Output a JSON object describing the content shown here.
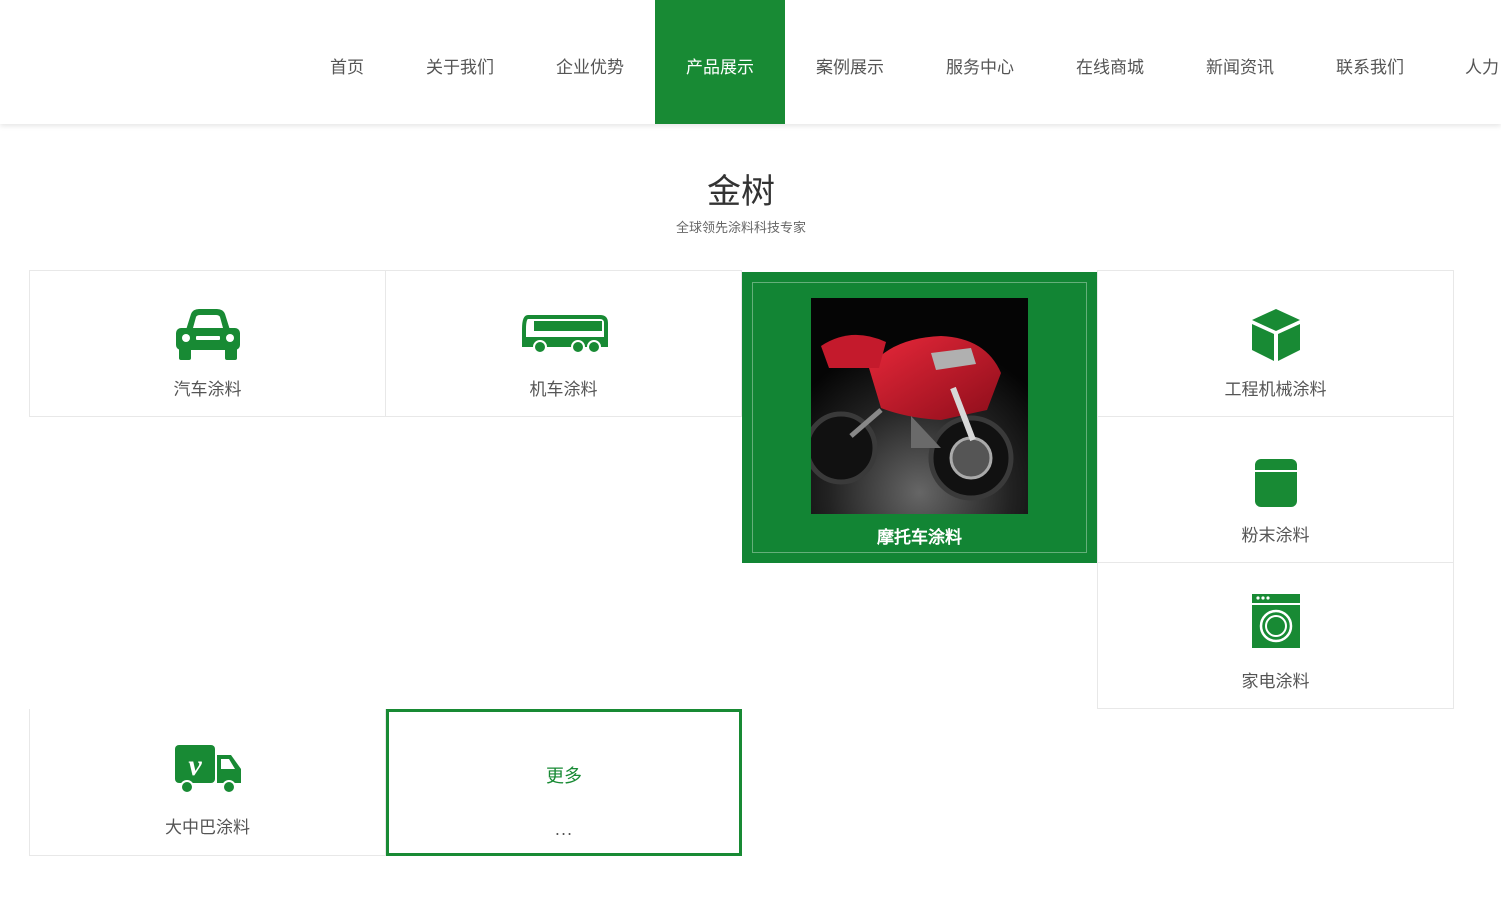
{
  "nav": {
    "items": [
      "首页",
      "关于我们",
      "企业优势",
      "产品展示",
      "案例展示",
      "服务中心",
      "在线商城",
      "新闻资讯",
      "联系我们",
      "人力"
    ],
    "active_index": 3
  },
  "section": {
    "title": "金树",
    "subtitle": "全球领先涂料科技专家"
  },
  "products": {
    "car": {
      "label": "汽车涂料",
      "icon": "car-icon"
    },
    "bus": {
      "label": "机车涂料",
      "icon": "bus-icon"
    },
    "motorcycle": {
      "label": "摩托车涂料",
      "image": "red-sport-motorcycle-photo"
    },
    "machinery": {
      "label": "工程机械涂料",
      "icon": "cube-icon"
    },
    "powder": {
      "label": "粉末涂料",
      "icon": "container-icon"
    },
    "appliance": {
      "label": "家电涂料",
      "icon": "washing-machine-icon"
    },
    "truck": {
      "label": "大中巴涂料",
      "icon": "truck-icon"
    }
  },
  "more": {
    "label": "更多",
    "dots": "..."
  },
  "colors": {
    "brand_green": "#188a34",
    "featured_bg": "#128534",
    "text": "#555555"
  }
}
